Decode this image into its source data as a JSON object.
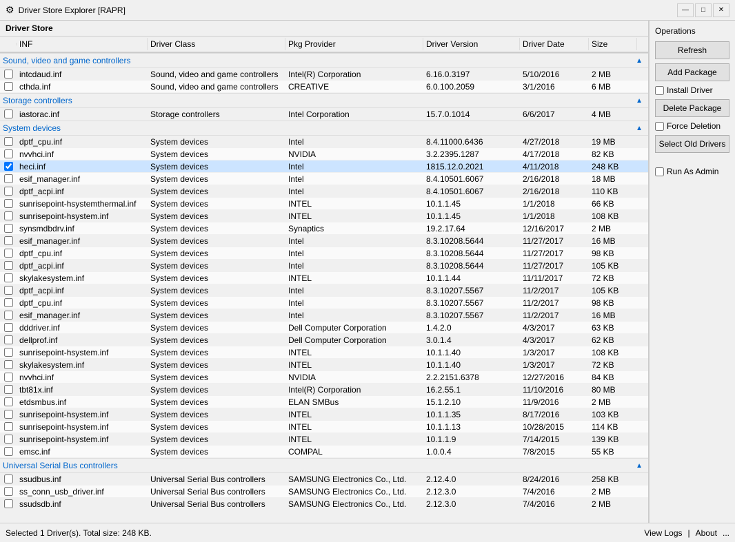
{
  "titleBar": {
    "icon": "⚙",
    "title": "Driver Store Explorer [RAPR]",
    "minimize": "—",
    "maximize": "□",
    "close": "✕"
  },
  "driverStore": {
    "label": "Driver Store"
  },
  "tableHeaders": {
    "inf": "INF",
    "driverClass": "Driver Class",
    "pkgProvider": "Pkg Provider",
    "driverVersion": "Driver Version",
    "driverDate": "Driver Date",
    "size": "Size"
  },
  "groups": [
    {
      "id": "sound",
      "label": "Sound, video and game controllers",
      "rows": [
        {
          "checked": false,
          "inf": "intcdaud.inf",
          "class": "Sound, video and game controllers",
          "provider": "Intel(R) Corporation",
          "version": "6.16.0.3197",
          "date": "5/10/2016",
          "size": "2 MB"
        },
        {
          "checked": false,
          "inf": "cthda.inf",
          "class": "Sound, video and game controllers",
          "provider": "CREATIVE",
          "version": "6.0.100.2059",
          "date": "3/1/2016",
          "size": "6 MB"
        }
      ]
    },
    {
      "id": "storage",
      "label": "Storage controllers",
      "rows": [
        {
          "checked": false,
          "inf": "iastorac.inf",
          "class": "Storage controllers",
          "provider": "Intel Corporation",
          "version": "15.7.0.1014",
          "date": "6/6/2017",
          "size": "4 MB"
        }
      ]
    },
    {
      "id": "system",
      "label": "System devices",
      "rows": [
        {
          "checked": false,
          "inf": "dptf_cpu.inf",
          "class": "System devices",
          "provider": "Intel",
          "version": "8.4.11000.6436",
          "date": "4/27/2018",
          "size": "19 MB"
        },
        {
          "checked": false,
          "inf": "nvvhci.inf",
          "class": "System devices",
          "provider": "NVIDIA",
          "version": "3.2.2395.1287",
          "date": "4/17/2018",
          "size": "82 KB"
        },
        {
          "checked": true,
          "inf": "heci.inf",
          "class": "System devices",
          "provider": "Intel",
          "version": "1815.12.0.2021",
          "date": "4/11/2018",
          "size": "248 KB"
        },
        {
          "checked": false,
          "inf": "esif_manager.inf",
          "class": "System devices",
          "provider": "Intel",
          "version": "8.4.10501.6067",
          "date": "2/16/2018",
          "size": "18 MB"
        },
        {
          "checked": false,
          "inf": "dptf_acpi.inf",
          "class": "System devices",
          "provider": "Intel",
          "version": "8.4.10501.6067",
          "date": "2/16/2018",
          "size": "110 KB"
        },
        {
          "checked": false,
          "inf": "sunrisepoint-hsystemthermal.inf",
          "class": "System devices",
          "provider": "INTEL",
          "version": "10.1.1.45",
          "date": "1/1/2018",
          "size": "66 KB"
        },
        {
          "checked": false,
          "inf": "sunrisepoint-hsystem.inf",
          "class": "System devices",
          "provider": "INTEL",
          "version": "10.1.1.45",
          "date": "1/1/2018",
          "size": "108 KB"
        },
        {
          "checked": false,
          "inf": "synsmdbdrv.inf",
          "class": "System devices",
          "provider": "Synaptics",
          "version": "19.2.17.64",
          "date": "12/16/2017",
          "size": "2 MB"
        },
        {
          "checked": false,
          "inf": "esif_manager.inf",
          "class": "System devices",
          "provider": "Intel",
          "version": "8.3.10208.5644",
          "date": "11/27/2017",
          "size": "16 MB"
        },
        {
          "checked": false,
          "inf": "dptf_cpu.inf",
          "class": "System devices",
          "provider": "Intel",
          "version": "8.3.10208.5644",
          "date": "11/27/2017",
          "size": "98 KB"
        },
        {
          "checked": false,
          "inf": "dptf_acpi.inf",
          "class": "System devices",
          "provider": "Intel",
          "version": "8.3.10208.5644",
          "date": "11/27/2017",
          "size": "105 KB"
        },
        {
          "checked": false,
          "inf": "skylakesystem.inf",
          "class": "System devices",
          "provider": "INTEL",
          "version": "10.1.1.44",
          "date": "11/11/2017",
          "size": "72 KB"
        },
        {
          "checked": false,
          "inf": "dptf_acpi.inf",
          "class": "System devices",
          "provider": "Intel",
          "version": "8.3.10207.5567",
          "date": "11/2/2017",
          "size": "105 KB"
        },
        {
          "checked": false,
          "inf": "dptf_cpu.inf",
          "class": "System devices",
          "provider": "Intel",
          "version": "8.3.10207.5567",
          "date": "11/2/2017",
          "size": "98 KB"
        },
        {
          "checked": false,
          "inf": "esif_manager.inf",
          "class": "System devices",
          "provider": "Intel",
          "version": "8.3.10207.5567",
          "date": "11/2/2017",
          "size": "16 MB"
        },
        {
          "checked": false,
          "inf": "dddriver.inf",
          "class": "System devices",
          "provider": "Dell Computer Corporation",
          "version": "1.4.2.0",
          "date": "4/3/2017",
          "size": "63 KB"
        },
        {
          "checked": false,
          "inf": "dellprof.inf",
          "class": "System devices",
          "provider": "Dell Computer Corporation",
          "version": "3.0.1.4",
          "date": "4/3/2017",
          "size": "62 KB"
        },
        {
          "checked": false,
          "inf": "sunrisepoint-hsystem.inf",
          "class": "System devices",
          "provider": "INTEL",
          "version": "10.1.1.40",
          "date": "1/3/2017",
          "size": "108 KB"
        },
        {
          "checked": false,
          "inf": "skylakesystem.inf",
          "class": "System devices",
          "provider": "INTEL",
          "version": "10.1.1.40",
          "date": "1/3/2017",
          "size": "72 KB"
        },
        {
          "checked": false,
          "inf": "nvvhci.inf",
          "class": "System devices",
          "provider": "NVIDIA",
          "version": "2.2.2151.6378",
          "date": "12/27/2016",
          "size": "84 KB"
        },
        {
          "checked": false,
          "inf": "tbt81x.inf",
          "class": "System devices",
          "provider": "Intel(R) Corporation",
          "version": "16.2.55.1",
          "date": "11/10/2016",
          "size": "80 MB"
        },
        {
          "checked": false,
          "inf": "etdsmbus.inf",
          "class": "System devices",
          "provider": "ELAN SMBus",
          "version": "15.1.2.10",
          "date": "11/9/2016",
          "size": "2 MB"
        },
        {
          "checked": false,
          "inf": "sunrisepoint-hsystem.inf",
          "class": "System devices",
          "provider": "INTEL",
          "version": "10.1.1.35",
          "date": "8/17/2016",
          "size": "103 KB"
        },
        {
          "checked": false,
          "inf": "sunrisepoint-hsystem.inf",
          "class": "System devices",
          "provider": "INTEL",
          "version": "10.1.1.13",
          "date": "10/28/2015",
          "size": "114 KB"
        },
        {
          "checked": false,
          "inf": "sunrisepoint-hsystem.inf",
          "class": "System devices",
          "provider": "INTEL",
          "version": "10.1.1.9",
          "date": "7/14/2015",
          "size": "139 KB"
        },
        {
          "checked": false,
          "inf": "emsc.inf",
          "class": "System devices",
          "provider": "COMPAL",
          "version": "1.0.0.4",
          "date": "7/8/2015",
          "size": "55 KB"
        }
      ]
    },
    {
      "id": "usb",
      "label": "Universal Serial Bus controllers",
      "rows": [
        {
          "checked": false,
          "inf": "ssudbus.inf",
          "class": "Universal Serial Bus controllers",
          "provider": "SAMSUNG Electronics Co., Ltd.",
          "version": "2.12.4.0",
          "date": "8/24/2016",
          "size": "258 KB"
        },
        {
          "checked": false,
          "inf": "ss_conn_usb_driver.inf",
          "class": "Universal Serial Bus controllers",
          "provider": "SAMSUNG Electronics Co., Ltd.",
          "version": "2.12.3.0",
          "date": "7/4/2016",
          "size": "2 MB"
        },
        {
          "checked": false,
          "inf": "ssudsdb.inf",
          "class": "Universal Serial Bus controllers",
          "provider": "SAMSUNG Electronics Co., Ltd.",
          "version": "2.12.3.0",
          "date": "7/4/2016",
          "size": "2 MB"
        }
      ]
    }
  ],
  "operations": {
    "label": "Operations",
    "refresh": "Refresh",
    "addPackage": "Add Package",
    "installDriverLabel": "Install Driver",
    "deletePackage": "Delete Package",
    "forceDeletionLabel": "Force Deletion",
    "selectOldDrivers": "Select Old Drivers",
    "runAsAdminLabel": "Run As Admin"
  },
  "statusBar": {
    "text": "Selected 1 Driver(s). Total size: 248 KB.",
    "viewLogs": "View Logs",
    "about": "About",
    "dots": "..."
  }
}
